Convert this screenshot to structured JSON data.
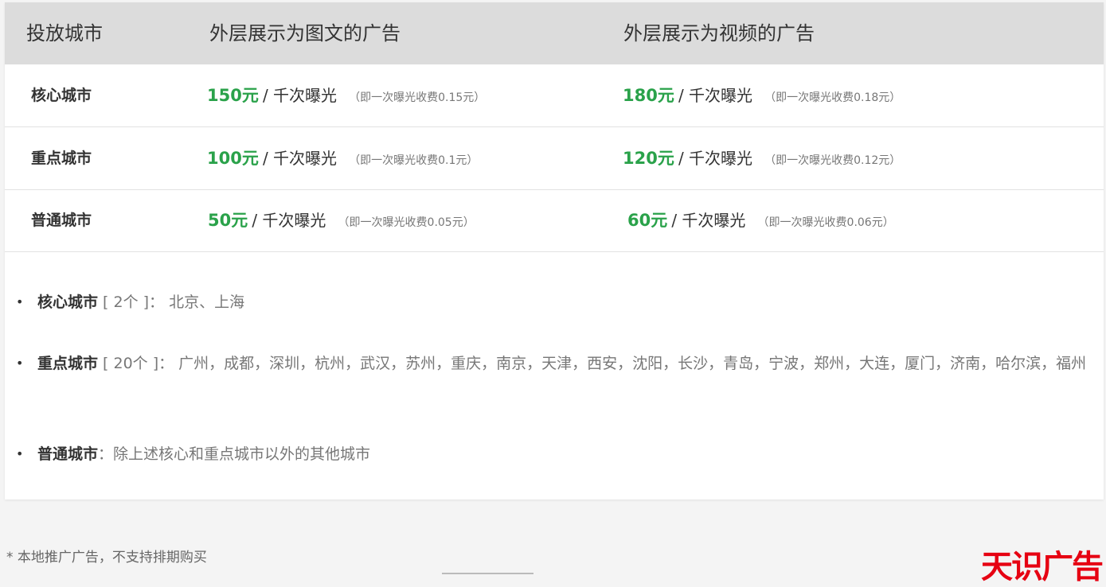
{
  "table": {
    "headers": [
      "投放城市",
      "外层展示为图文的广告",
      "外层展示为视频的广告"
    ],
    "rows": [
      {
        "city": "核心城市",
        "image_price": "150元",
        "image_unit": "/ 千次曝光",
        "image_note": "（即一次曝光收费0.15元）",
        "video_price": "180元",
        "video_unit": "/ 千次曝光",
        "video_note": "（即一次曝光收费0.18元）"
      },
      {
        "city": "重点城市",
        "image_price": "100元",
        "image_unit": "/ 千次曝光",
        "image_note": "（即一次曝光收费0.1元）",
        "video_price": "120元",
        "video_unit": "/ 千次曝光",
        "video_note": "（即一次曝光收费0.12元）"
      },
      {
        "city": "普通城市",
        "image_price": "50元",
        "image_unit": "/ 千次曝光",
        "image_note": "（即一次曝光收费0.05元）",
        "video_price": "60元",
        "video_unit": "/ 千次曝光",
        "video_note": "（即一次曝光收费0.06元）"
      }
    ]
  },
  "city_list": [
    {
      "label": "核心城市",
      "detail": " [ 2个 ]： 北京、上海"
    },
    {
      "label": "重点城市",
      "detail": " [ 20个 ]： 广州，成都，深圳，杭州，武汉，苏州，重庆，南京，天津，西安，沈阳，长沙，青岛，宁波，郑州，大连，厦门，济南，哈尔滨，福州"
    },
    {
      "label": "普通城市",
      "detail": "：除上述核心和重点城市以外的其他城市"
    }
  ],
  "footnote": "* 本地推广广告，不支持排期购买",
  "logo_text": "天识广告",
  "colors": {
    "price_green": "#2aa24a",
    "logo_red": "#e60012",
    "header_bg": "#dcdcdc"
  }
}
